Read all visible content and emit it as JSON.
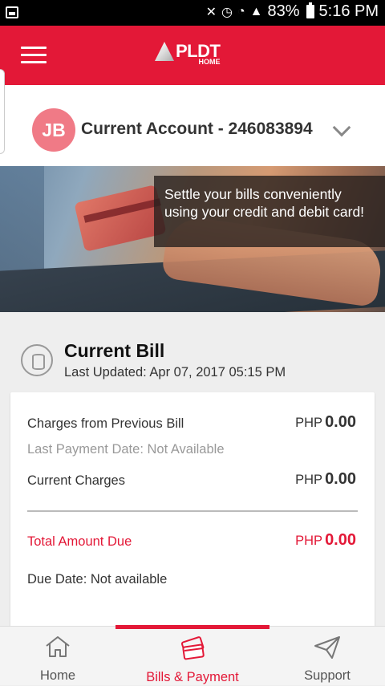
{
  "status_bar": {
    "battery": "83%",
    "time": "5:16 PM"
  },
  "app_bar": {
    "logo": "PLDT",
    "logo_sub": "HOME"
  },
  "account": {
    "initials": "JB",
    "title": "Current Account - 246083894"
  },
  "banner": {
    "caption": "Settle your bills conveniently using your credit and debit card!"
  },
  "bill": {
    "title": "Current Bill",
    "last_updated": "Last Updated: Apr 07, 2017 05:15 PM",
    "previous_label": "Charges from Previous Bill",
    "previous_currency": "PHP",
    "previous_amount": "0.00",
    "last_payment": "Last Payment Date: Not Available",
    "current_label": "Current Charges",
    "current_currency": "PHP",
    "current_amount": "0.00",
    "total_label": "Total Amount Due",
    "total_currency": "PHP",
    "total_amount": "0.00",
    "due_date": "Due Date: Not available"
  },
  "nav": {
    "home": "Home",
    "bills": "Bills & Payment",
    "support": "Support"
  },
  "colors": {
    "brand_red": "#e31837",
    "avatar": "#f07a86"
  }
}
